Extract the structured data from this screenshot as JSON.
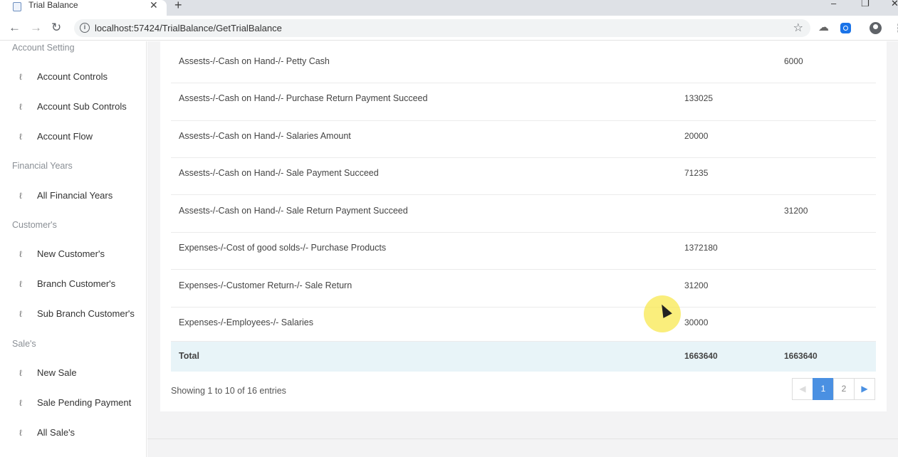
{
  "browser": {
    "tab_title": "Trial Balance",
    "tab_close": "✕",
    "new_tab": "+",
    "url": "localhost:57424/TrialBalance/GetTrialBalance",
    "window_controls": {
      "minimize": "–",
      "restore": "❐",
      "close": "✕"
    },
    "nav": {
      "back": "←",
      "forward": "→",
      "reload": "↻"
    }
  },
  "sidebar": {
    "sections": [
      {
        "header": "Account Setting",
        "items": [
          "Account Controls",
          "Account Sub Controls",
          "Account Flow"
        ]
      },
      {
        "header": "Financial Years",
        "items": [
          "All Financial Years"
        ]
      },
      {
        "header": "Customer's",
        "items": [
          "New Customer's",
          "Branch Customer's",
          "Sub Branch Customer's"
        ]
      },
      {
        "header": "Sale's",
        "items": [
          "New Sale",
          "Sale Pending Payment",
          "All Sale's"
        ]
      }
    ],
    "item_icon": "ℓ"
  },
  "table": {
    "rows": [
      {
        "account": "Assests-/-Cash on Hand-/- Petty Cash",
        "debit": "",
        "credit": "6000"
      },
      {
        "account": "Assests-/-Cash on Hand-/- Purchase Return Payment Succeed",
        "debit": "133025",
        "credit": ""
      },
      {
        "account": "Assests-/-Cash on Hand-/- Salaries Amount",
        "debit": "20000",
        "credit": ""
      },
      {
        "account": "Assests-/-Cash on Hand-/- Sale Payment Succeed",
        "debit": "71235",
        "credit": ""
      },
      {
        "account": "Assests-/-Cash on Hand-/- Sale Return Payment Succeed",
        "debit": "",
        "credit": "31200"
      },
      {
        "account": "Expenses-/-Cost of good solds-/- Purchase Products",
        "debit": "1372180",
        "credit": ""
      },
      {
        "account": "Expenses-/-Customer Return-/- Sale Return",
        "debit": "31200",
        "credit": ""
      },
      {
        "account": "Expenses-/-Employees-/- Salaries",
        "debit": "30000",
        "credit": ""
      }
    ],
    "total": {
      "label": "Total",
      "debit": "1663640",
      "credit": "1663640"
    }
  },
  "footer": {
    "showing": "Showing 1 to 10 of 16 entries",
    "pagination": {
      "prev": "◀",
      "pages": [
        "1",
        "2"
      ],
      "next": "▶",
      "active": "1"
    }
  }
}
